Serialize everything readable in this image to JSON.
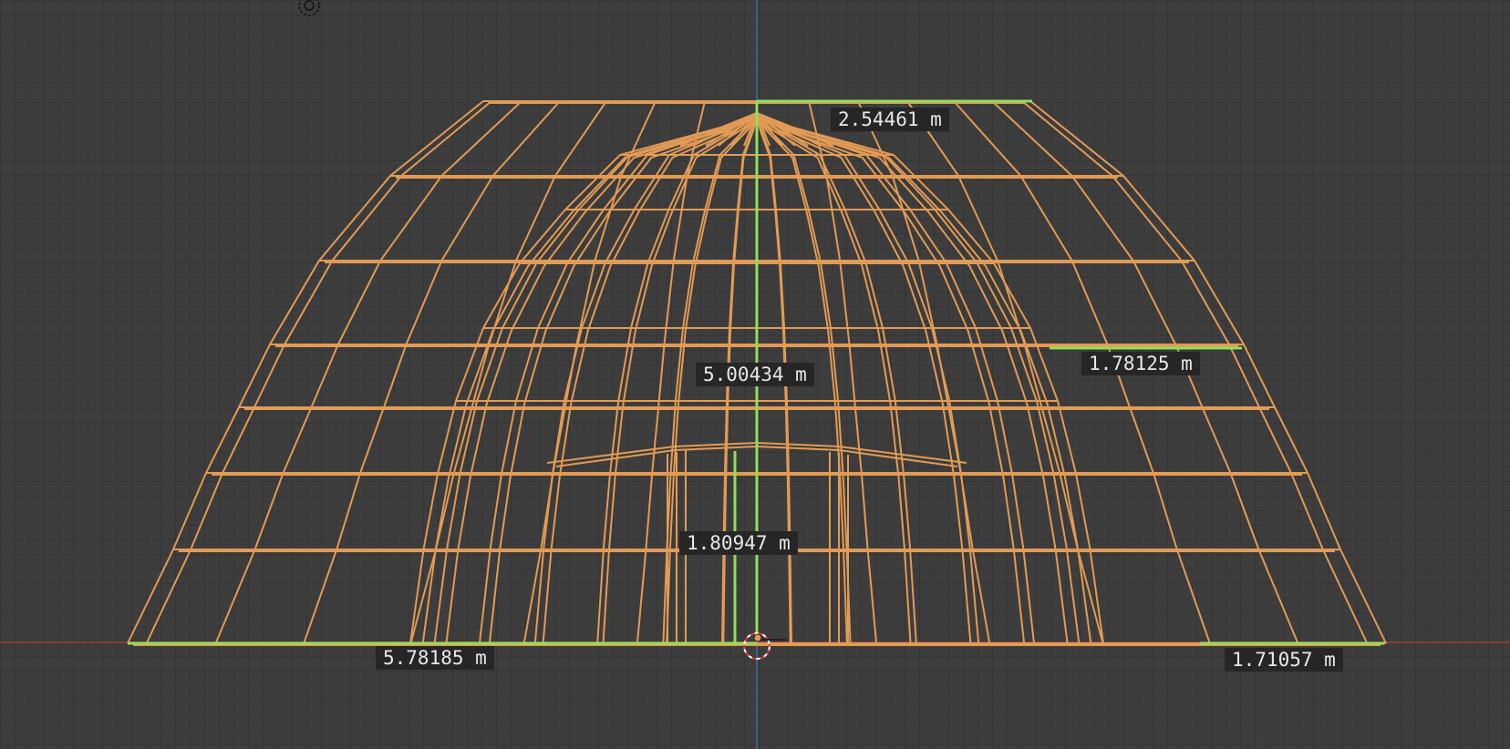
{
  "viewport": {
    "name": "3D viewport",
    "view": "Front orthographic, wireframe",
    "colors": {
      "background": "#3d3d3d",
      "grid": "#353535",
      "wireframe": "#e29b55",
      "measure_line": "#8fe05a",
      "x_axis": "#8a3a3a",
      "z_axis": "#3f5f8a",
      "label_bg": "#262626",
      "label_text": "#e8e8e8"
    }
  },
  "measurements": [
    {
      "id": "top-width",
      "label": "2.54461 m"
    },
    {
      "id": "total-height",
      "label": "5.00434 m"
    },
    {
      "id": "right-step",
      "label": "1.78125 m"
    },
    {
      "id": "inner-height",
      "label": "1.80947 m"
    },
    {
      "id": "base-half-width",
      "label": "5.78185 m"
    },
    {
      "id": "right-base-offset",
      "label": "1.71057 m"
    }
  ],
  "icons": {
    "light_gizmo": "sun-light-icon",
    "cursor": "3d-cursor-icon",
    "origin": "object-origin-icon"
  }
}
